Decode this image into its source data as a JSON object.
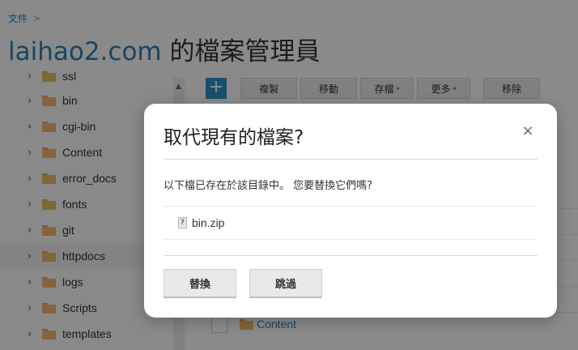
{
  "breadcrumb": {
    "root": "文件",
    "separator": ">"
  },
  "title": {
    "domain": "laihao2.com",
    "suffix": " 的檔案管理員"
  },
  "sidebar": {
    "items": [
      {
        "label": "ssl",
        "highlighted": false
      },
      {
        "label": "bin",
        "highlighted": false
      },
      {
        "label": "cgi-bin",
        "highlighted": false
      },
      {
        "label": "Content",
        "highlighted": false
      },
      {
        "label": "error_docs",
        "highlighted": false
      },
      {
        "label": "fonts",
        "highlighted": false
      },
      {
        "label": "git",
        "highlighted": false
      },
      {
        "label": "httpdocs",
        "highlighted": true
      },
      {
        "label": "logs",
        "highlighted": false
      },
      {
        "label": "Scripts",
        "highlighted": false
      },
      {
        "label": "templates",
        "highlighted": false
      }
    ]
  },
  "toolbar": {
    "add_label": "+",
    "copy_label": "複製",
    "move_label": "移動",
    "archive_label": "存檔",
    "more_label": "更多",
    "remove_label": "移除"
  },
  "filelist": {
    "visible_row_label": "Content"
  },
  "dialog": {
    "title": "取代現有的檔案?",
    "message": "以下檔已存在於該目錄中。 您要替換它們嗎?",
    "file_name": "bin.zip",
    "replace_label": "替換",
    "skip_label": "跳過",
    "close_glyph": "×"
  },
  "colors": {
    "accent": "#2f7fb4",
    "add_button": "#2f91c8",
    "folder": "#f0b66a",
    "overlay": "rgba(0,0,0,0.45)"
  }
}
